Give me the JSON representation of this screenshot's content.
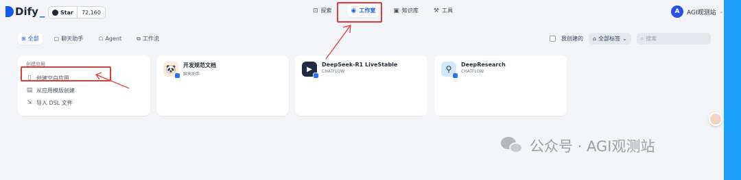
{
  "brand": {
    "name": "Dify"
  },
  "github": {
    "star_label": "Star",
    "count": "72,160"
  },
  "nav": {
    "items": [
      {
        "label": "探索",
        "icon": "compass-icon"
      },
      {
        "label": "工作室",
        "icon": "robot-icon",
        "active": true
      },
      {
        "label": "知识库",
        "icon": "book-icon"
      },
      {
        "label": "工具",
        "icon": "tool-icon"
      }
    ]
  },
  "account": {
    "initial": "A",
    "name": "AGI观测站"
  },
  "filters": {
    "tabs": [
      {
        "label": "全部",
        "active": true
      },
      {
        "label": "聊天助手"
      },
      {
        "label": "Agent"
      },
      {
        "label": "工作流"
      }
    ],
    "my_created_label": "我创建的",
    "tags_label": "全部标签",
    "search_placeholder": "搜索"
  },
  "create_card": {
    "title": "创建应用",
    "items": [
      {
        "label": "创建空白应用",
        "icon": "file-plus-icon"
      },
      {
        "label": "从应用模版创建",
        "icon": "template-icon"
      },
      {
        "label": "导入 DSL 文件",
        "icon": "import-icon"
      }
    ]
  },
  "apps": [
    {
      "name": "开发规范文档",
      "type": "聊天助手",
      "icon": "panda-icon",
      "icon_bg": "#fdead7"
    },
    {
      "name": "DeepSeek-R1 LiveStable",
      "type": "CHATFLOW",
      "icon": "play-icon",
      "icon_bg": "#1f2a44"
    },
    {
      "name": "DeepResearch",
      "type": "CHATFLOW",
      "icon": "magnifier-icon",
      "icon_bg": "#d1e9ff"
    }
  ],
  "watermark": {
    "text": "公众号 · AGI观测站"
  },
  "colors": {
    "accent": "#155aef",
    "annotation": "#e53935",
    "edge": "#1ba0f5"
  }
}
